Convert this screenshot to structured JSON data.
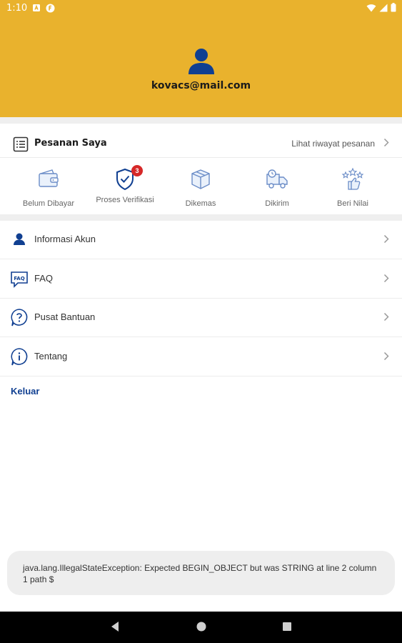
{
  "status_bar": {
    "time": "1:10"
  },
  "profile": {
    "email": "kovacs@mail.com"
  },
  "orders": {
    "title": "Pesanan Saya",
    "history_link": "Lihat riwayat pesanan",
    "statuses": [
      {
        "label": "Belum Dibayar",
        "icon": "wallet-icon"
      },
      {
        "label": "Proses Verifikasi",
        "icon": "shield-check-icon",
        "badge": "3"
      },
      {
        "label": "Dikemas",
        "icon": "box-icon"
      },
      {
        "label": "Dikirim",
        "icon": "delivery-truck-icon"
      },
      {
        "label": "Beri Nilai",
        "icon": "rating-stars-icon"
      }
    ]
  },
  "menu": [
    {
      "label": "Informasi Akun",
      "icon": "user-icon"
    },
    {
      "label": "FAQ",
      "icon": "faq-icon"
    },
    {
      "label": "Pusat Bantuan",
      "icon": "help-icon"
    },
    {
      "label": "Tentang",
      "icon": "info-icon"
    }
  ],
  "logout_label": "Keluar",
  "toast": {
    "message": "java.lang.IllegalStateException: Expected BEGIN_OBJECT but was STRING at line 2 column 1 path $"
  },
  "colors": {
    "header": "#E9B22D",
    "accent": "#103F91",
    "badge": "#D62828"
  }
}
